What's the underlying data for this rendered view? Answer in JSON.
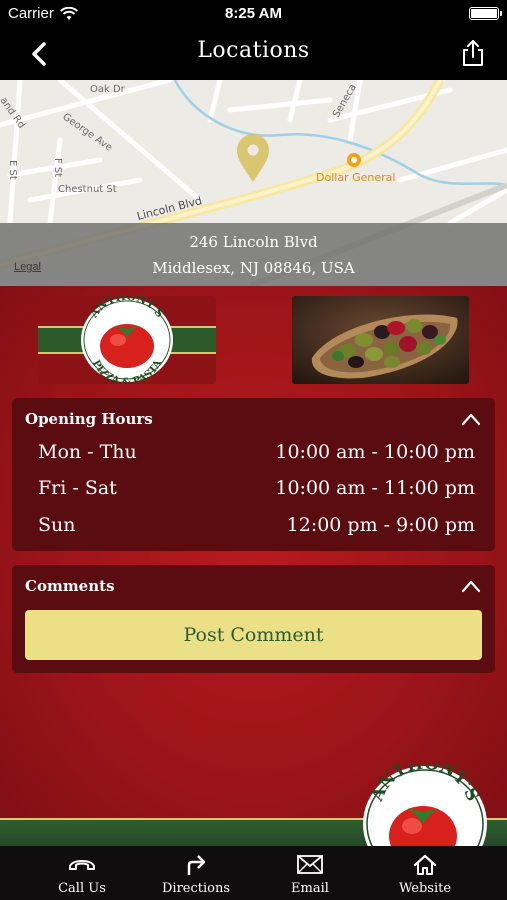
{
  "status_bar": {
    "carrier": "Carrier",
    "time": "8:25 AM"
  },
  "nav": {
    "title": "Locations",
    "back_icon": "chevron-left-icon",
    "share_icon": "share-icon"
  },
  "map": {
    "streets": [
      "Oak Dr",
      "George Ave",
      "Chestnut St",
      "Lincoln Blvd",
      "E St",
      "F St",
      "and Rd",
      "Seneca"
    ],
    "poi": "Dollar General",
    "legal": "Legal",
    "address_line1": "246 Lincoln Blvd",
    "address_line2": "Middlesex, NJ 08846, USA"
  },
  "logo_text": {
    "top": "ANTHONY'S",
    "bottom": "PIZZA & PASTA"
  },
  "hours": {
    "title": "Opening Hours",
    "rows": [
      {
        "day": "Mon - Thu",
        "time": "10:00 am - 10:00 pm"
      },
      {
        "day": "Fri - Sat",
        "time": "10:00 am - 11:00 pm"
      },
      {
        "day": "Sun",
        "time": "12:00 pm - 9:00 pm"
      }
    ]
  },
  "comments": {
    "title": "Comments",
    "post_label": "Post Comment"
  },
  "tabs": [
    {
      "label": "Call Us",
      "icon": "phone-icon"
    },
    {
      "label": "Directions",
      "icon": "directions-icon"
    },
    {
      "label": "Email",
      "icon": "email-icon"
    },
    {
      "label": "Website",
      "icon": "home-icon"
    }
  ],
  "colors": {
    "nav_bg": "#000000",
    "main_red": "#9a1419",
    "card_bg": "#5b0c10",
    "button_yellow": "#ece086",
    "button_text_green": "#2d5a2f",
    "pin_gold": "#d8c46a"
  }
}
